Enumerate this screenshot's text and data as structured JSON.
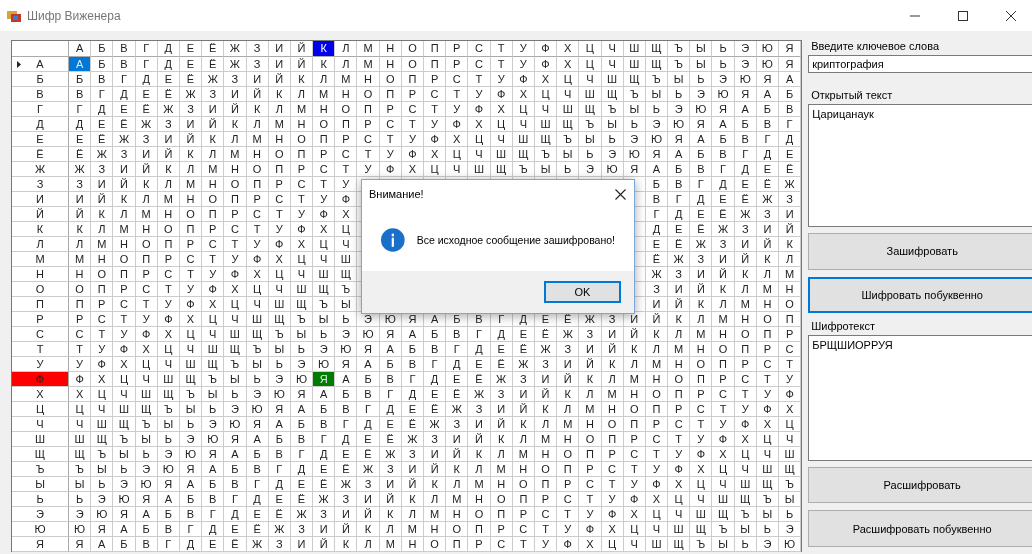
{
  "window": {
    "title": "Шифр Виженера"
  },
  "table": {
    "columns": [
      {
        "label": "А",
        "selected": false
      },
      {
        "label": "Б",
        "selected": false
      },
      {
        "label": "В",
        "selected": false
      },
      {
        "label": "Г",
        "selected": false
      },
      {
        "label": "Д",
        "selected": false
      },
      {
        "label": "Е",
        "selected": false
      },
      {
        "label": "Ё",
        "selected": false
      },
      {
        "label": "Ж",
        "selected": false
      },
      {
        "label": "З",
        "selected": false
      },
      {
        "label": "И",
        "selected": false
      },
      {
        "label": "Й",
        "selected": false
      },
      {
        "label": "К",
        "selected": true
      },
      {
        "label": "Л",
        "selected": false
      },
      {
        "label": "М",
        "selected": false
      },
      {
        "label": "Н",
        "selected": false
      },
      {
        "label": "О",
        "selected": false
      },
      {
        "label": "П",
        "selected": false
      },
      {
        "label": "Р",
        "selected": false
      },
      {
        "label": "С",
        "selected": false
      },
      {
        "label": "Т",
        "selected": false
      },
      {
        "label": "У",
        "selected": false
      },
      {
        "label": "Ф",
        "selected": false
      },
      {
        "label": "Х",
        "selected": false
      },
      {
        "label": "Ц",
        "selected": false
      },
      {
        "label": "Ч",
        "selected": false
      },
      {
        "label": "Ш",
        "selected": false
      },
      {
        "label": "Щ",
        "selected": false
      },
      {
        "label": "Ъ",
        "selected": false
      },
      {
        "label": "Ы",
        "selected": false
      },
      {
        "label": "Ь",
        "selected": false
      },
      {
        "label": "Э",
        "selected": false
      },
      {
        "label": "Ю",
        "selected": false
      },
      {
        "label": "Я",
        "selected": false
      }
    ],
    "rows": [
      {
        "header": "А",
        "current": true,
        "selected": false,
        "cells": [
          {
            "text": "А",
            "color": "#0078d7"
          },
          "Б",
          "В",
          "Г",
          "Д",
          "Е",
          "Ё",
          "Ж",
          "З",
          "И",
          "Й",
          "К",
          "Л",
          "М",
          "Н",
          "О",
          "П",
          "Р",
          "С",
          "Т",
          "У",
          "Ф",
          "Х",
          "Ц",
          "Ч",
          "Ш",
          "Щ",
          "Ъ",
          "Ы",
          "Ь",
          "Э",
          "Ю",
          "Я"
        ]
      },
      {
        "header": "Б",
        "current": false,
        "selected": false,
        "cells": [
          "Б",
          "В",
          "Г",
          "Д",
          "Е",
          "Ё",
          "Ж",
          "З",
          "И",
          "Й",
          "К",
          "Л",
          "М",
          "Н",
          "О",
          "П",
          "Р",
          "С",
          "Т",
          "У",
          "Ф",
          "Х",
          "Ц",
          "Ч",
          "Ш",
          "Щ",
          "Ъ",
          "Ы",
          "Ь",
          "Э",
          "Ю",
          "Я",
          "А"
        ]
      },
      {
        "header": "В",
        "current": false,
        "selected": false,
        "cells": [
          "В",
          "Г",
          "Д",
          "Е",
          "Ё",
          "Ж",
          "З",
          "И",
          "Й",
          "К",
          "Л",
          "М",
          "Н",
          "О",
          "П",
          "Р",
          "С",
          "Т",
          "У",
          "Ф",
          "Х",
          "Ц",
          "Ч",
          "Ш",
          "Щ",
          "Ъ",
          "Ы",
          "Ь",
          "Э",
          "Ю",
          "Я",
          "А",
          "Б"
        ]
      },
      {
        "header": "Г",
        "current": false,
        "selected": false,
        "cells": [
          "Г",
          "Д",
          "Е",
          "Ё",
          "Ж",
          "З",
          "И",
          "Й",
          "К",
          "Л",
          "М",
          "Н",
          "О",
          "П",
          "Р",
          "С",
          "Т",
          "У",
          "Ф",
          "Х",
          "Ц",
          "Ч",
          "Ш",
          "Щ",
          "Ъ",
          "Ы",
          "Ь",
          "Э",
          "Ю",
          "Я",
          "А",
          "Б",
          "В"
        ]
      },
      {
        "header": "Д",
        "current": false,
        "selected": false,
        "cells": [
          "Д",
          "Е",
          "Ё",
          "Ж",
          "З",
          "И",
          "Й",
          "К",
          "Л",
          "М",
          "Н",
          "О",
          "П",
          "Р",
          "С",
          "Т",
          "У",
          "Ф",
          "Х",
          "Ц",
          "Ч",
          "Ш",
          "Щ",
          "Ъ",
          "Ы",
          "Ь",
          "Э",
          "Ю",
          "Я",
          "А",
          "Б",
          "В",
          "Г"
        ]
      },
      {
        "header": "Е",
        "current": false,
        "selected": false,
        "cells": [
          "Е",
          "Ё",
          "Ж",
          "З",
          "И",
          "Й",
          "К",
          "Л",
          "М",
          "Н",
          "О",
          "П",
          "Р",
          "С",
          "Т",
          "У",
          "Ф",
          "Х",
          "Ц",
          "Ч",
          "Ш",
          "Щ",
          "Ъ",
          "Ы",
          "Ь",
          "Э",
          "Ю",
          "Я",
          "А",
          "Б",
          "В",
          "Г",
          "Д"
        ]
      },
      {
        "header": "Ё",
        "current": false,
        "selected": false,
        "cells": [
          "Ё",
          "Ж",
          "З",
          "И",
          "Й",
          "К",
          "Л",
          "М",
          "Н",
          "О",
          "П",
          "Р",
          "С",
          "Т",
          "У",
          "Ф",
          "Х",
          "Ц",
          "Ч",
          "Ш",
          "Щ",
          "Ъ",
          "Ы",
          "Ь",
          "Э",
          "Ю",
          "Я",
          "А",
          "Б",
          "В",
          "Г",
          "Д",
          "Е"
        ]
      },
      {
        "header": "Ж",
        "current": false,
        "selected": false,
        "cells": [
          "Ж",
          "З",
          "И",
          "Й",
          "К",
          "Л",
          "М",
          "Н",
          "О",
          "П",
          "Р",
          "С",
          "Т",
          "У",
          "Ф",
          "Х",
          "Ц",
          "Ч",
          "Ш",
          "Щ",
          "Ъ",
          "Ы",
          "Ь",
          "Э",
          "Ю",
          "Я",
          "А",
          "Б",
          "В",
          "Г",
          "Д",
          "Е",
          "Ё"
        ]
      },
      {
        "header": "З",
        "current": false,
        "selected": false,
        "cells": [
          "З",
          "И",
          "Й",
          "К",
          "Л",
          "М",
          "Н",
          "О",
          "П",
          "Р",
          "С",
          "Т",
          "У",
          null,
          null,
          null,
          null,
          null,
          null,
          null,
          null,
          null,
          null,
          null,
          null,
          null,
          "Б",
          "В",
          "Г",
          "Д",
          "Е",
          "Ё",
          "Ж"
        ]
      },
      {
        "header": "И",
        "current": false,
        "selected": false,
        "cells": [
          "И",
          "Й",
          "К",
          "Л",
          "М",
          "Н",
          "О",
          "П",
          "Р",
          "С",
          "Т",
          "У",
          "Ф",
          null,
          null,
          null,
          null,
          null,
          null,
          null,
          null,
          null,
          null,
          null,
          null,
          null,
          "В",
          "Г",
          "Д",
          "Е",
          "Ё",
          "Ж",
          "З"
        ]
      },
      {
        "header": "Й",
        "current": false,
        "selected": false,
        "cells": [
          "Й",
          "К",
          "Л",
          "М",
          "Н",
          "О",
          "П",
          "Р",
          "С",
          "Т",
          "У",
          "Ф",
          "Х",
          null,
          null,
          null,
          null,
          null,
          null,
          null,
          null,
          null,
          null,
          null,
          null,
          null,
          "Г",
          "Д",
          "Е",
          "Ё",
          "Ж",
          "З",
          "И"
        ]
      },
      {
        "header": "К",
        "current": false,
        "selected": false,
        "cells": [
          "К",
          "Л",
          "М",
          "Н",
          "О",
          "П",
          "Р",
          "С",
          "Т",
          "У",
          "Ф",
          "Х",
          "Ц",
          null,
          null,
          null,
          null,
          null,
          null,
          null,
          null,
          null,
          null,
          null,
          null,
          null,
          "Д",
          "Е",
          "Ё",
          "Ж",
          "З",
          "И",
          "Й"
        ]
      },
      {
        "header": "Л",
        "current": false,
        "selected": false,
        "cells": [
          "Л",
          "М",
          "Н",
          "О",
          "П",
          "Р",
          "С",
          "Т",
          "У",
          "Ф",
          "Х",
          "Ц",
          "Ч",
          null,
          null,
          null,
          null,
          null,
          null,
          null,
          null,
          null,
          null,
          null,
          null,
          null,
          "Е",
          "Ё",
          "Ж",
          "З",
          "И",
          "Й",
          "К"
        ]
      },
      {
        "header": "М",
        "current": false,
        "selected": false,
        "cells": [
          "М",
          "Н",
          "О",
          "П",
          "Р",
          "С",
          "Т",
          "У",
          "Ф",
          "Х",
          "Ц",
          "Ч",
          "Ш",
          null,
          null,
          null,
          null,
          null,
          null,
          null,
          null,
          null,
          null,
          null,
          null,
          null,
          "Ё",
          "Ж",
          "З",
          "И",
          "Й",
          "К",
          "Л"
        ]
      },
      {
        "header": "Н",
        "current": false,
        "selected": false,
        "cells": [
          "Н",
          "О",
          "П",
          "Р",
          "С",
          "Т",
          "У",
          "Ф",
          "Х",
          "Ц",
          "Ч",
          "Ш",
          "Щ",
          null,
          null,
          null,
          null,
          null,
          null,
          null,
          null,
          null,
          null,
          null,
          null,
          null,
          "Ж",
          "З",
          "И",
          "Й",
          "К",
          "Л",
          "М"
        ]
      },
      {
        "header": "О",
        "current": false,
        "selected": false,
        "cells": [
          "О",
          "П",
          "Р",
          "С",
          "Т",
          "У",
          "Ф",
          "Х",
          "Ц",
          "Ч",
          "Ш",
          "Щ",
          "Ъ",
          null,
          null,
          null,
          null,
          null,
          null,
          null,
          null,
          null,
          null,
          null,
          null,
          null,
          "З",
          "И",
          "Й",
          "К",
          "Л",
          "М",
          "Н"
        ]
      },
      {
        "header": "П",
        "current": false,
        "selected": false,
        "cells": [
          "П",
          "Р",
          "С",
          "Т",
          "У",
          "Ф",
          "Х",
          "Ц",
          "Ч",
          "Ш",
          "Щ",
          "Ъ",
          "Ы",
          null,
          null,
          null,
          null,
          null,
          null,
          null,
          null,
          null,
          null,
          null,
          null,
          null,
          "И",
          "Й",
          "К",
          "Л",
          "М",
          "Н",
          "О"
        ]
      },
      {
        "header": "Р",
        "current": false,
        "selected": false,
        "cells": [
          "Р",
          "С",
          "Т",
          "У",
          "Ф",
          "Х",
          "Ц",
          "Ч",
          "Ш",
          "Щ",
          "Ъ",
          "Ы",
          "Ь",
          "Э",
          "Ю",
          "Я",
          "А",
          "Б",
          "В",
          "Г",
          "Д",
          "Е",
          "Ё",
          "Ж",
          "З",
          "И",
          "Й",
          "К",
          "Л",
          "М",
          "Н",
          "О",
          "П"
        ]
      },
      {
        "header": "С",
        "current": false,
        "selected": false,
        "cells": [
          "С",
          "Т",
          "У",
          "Ф",
          "Х",
          "Ц",
          "Ч",
          "Ш",
          "Щ",
          "Ъ",
          "Ы",
          "Ь",
          "Э",
          "Ю",
          "Я",
          "А",
          "Б",
          "В",
          "Г",
          "Д",
          "Е",
          "Ё",
          "Ж",
          "З",
          "И",
          "Й",
          "К",
          "Л",
          "М",
          "Н",
          "О",
          "П",
          "Р"
        ]
      },
      {
        "header": "Т",
        "current": false,
        "selected": false,
        "cells": [
          "Т",
          "У",
          "Ф",
          "Х",
          "Ц",
          "Ч",
          "Ш",
          "Щ",
          "Ъ",
          "Ы",
          "Ь",
          "Э",
          "Ю",
          "Я",
          "А",
          "Б",
          "В",
          "Г",
          "Д",
          "Е",
          "Ё",
          "Ж",
          "З",
          "И",
          "Й",
          "К",
          "Л",
          "М",
          "Н",
          "О",
          "П",
          "Р",
          "С"
        ]
      },
      {
        "header": "У",
        "current": false,
        "selected": false,
        "cells": [
          "У",
          "Ф",
          "Х",
          "Ц",
          "Ч",
          "Ш",
          "Щ",
          "Ъ",
          "Ы",
          "Ь",
          "Э",
          "Ю",
          "Я",
          "А",
          "Б",
          "В",
          "Г",
          "Д",
          "Е",
          "Ё",
          "Ж",
          "З",
          "И",
          "Й",
          "К",
          "Л",
          "М",
          "Н",
          "О",
          "П",
          "Р",
          "С",
          "Т"
        ]
      },
      {
        "header": "Ф",
        "current": false,
        "selected": true,
        "cells": [
          "Ф",
          "Х",
          "Ц",
          "Ч",
          "Ш",
          "Щ",
          "Ъ",
          "Ы",
          "Ь",
          "Э",
          "Ю",
          {
            "text": "Я",
            "color": "#007d00"
          },
          "А",
          "Б",
          "В",
          "Г",
          "Д",
          "Е",
          "Ё",
          "Ж",
          "З",
          "И",
          "Й",
          "К",
          "Л",
          "М",
          "Н",
          "О",
          "П",
          "Р",
          "С",
          "Т",
          "У"
        ]
      },
      {
        "header": "Х",
        "current": false,
        "selected": false,
        "cells": [
          "Х",
          "Ц",
          "Ч",
          "Ш",
          "Щ",
          "Ъ",
          "Ы",
          "Ь",
          "Э",
          "Ю",
          "Я",
          "А",
          "Б",
          "В",
          "Г",
          "Д",
          "Е",
          "Ё",
          "Ж",
          "З",
          "И",
          "Й",
          "К",
          "Л",
          "М",
          "Н",
          "О",
          "П",
          "Р",
          "С",
          "Т",
          "У",
          "Ф"
        ]
      },
      {
        "header": "Ц",
        "current": false,
        "selected": false,
        "cells": [
          "Ц",
          "Ч",
          "Ш",
          "Щ",
          "Ъ",
          "Ы",
          "Ь",
          "Э",
          "Ю",
          "Я",
          "А",
          "Б",
          "В",
          "Г",
          "Д",
          "Е",
          "Ё",
          "Ж",
          "З",
          "И",
          "Й",
          "К",
          "Л",
          "М",
          "Н",
          "О",
          "П",
          "Р",
          "С",
          "Т",
          "У",
          "Ф",
          "Х"
        ]
      },
      {
        "header": "Ч",
        "current": false,
        "selected": false,
        "cells": [
          "Ч",
          "Ш",
          "Щ",
          "Ъ",
          "Ы",
          "Ь",
          "Э",
          "Ю",
          "Я",
          "А",
          "Б",
          "В",
          "Г",
          "Д",
          "Е",
          "Ё",
          "Ж",
          "З",
          "И",
          "Й",
          "К",
          "Л",
          "М",
          "Н",
          "О",
          "П",
          "Р",
          "С",
          "Т",
          "У",
          "Ф",
          "Х",
          "Ц"
        ]
      },
      {
        "header": "Ш",
        "current": false,
        "selected": false,
        "cells": [
          "Ш",
          "Щ",
          "Ъ",
          "Ы",
          "Ь",
          "Э",
          "Ю",
          "Я",
          "А",
          "Б",
          "В",
          "Г",
          "Д",
          "Е",
          "Ё",
          "Ж",
          "З",
          "И",
          "Й",
          "К",
          "Л",
          "М",
          "Н",
          "О",
          "П",
          "Р",
          "С",
          "Т",
          "У",
          "Ф",
          "Х",
          "Ц",
          "Ч"
        ]
      },
      {
        "header": "Щ",
        "current": false,
        "selected": false,
        "cells": [
          "Щ",
          "Ъ",
          "Ы",
          "Ь",
          "Э",
          "Ю",
          "Я",
          "А",
          "Б",
          "В",
          "Г",
          "Д",
          "Е",
          "Ё",
          "Ж",
          "З",
          "И",
          "Й",
          "К",
          "Л",
          "М",
          "Н",
          "О",
          "П",
          "Р",
          "С",
          "Т",
          "У",
          "Ф",
          "Х",
          "Ц",
          "Ч",
          "Ш"
        ]
      },
      {
        "header": "Ъ",
        "current": false,
        "selected": false,
        "cells": [
          "Ъ",
          "Ы",
          "Ь",
          "Э",
          "Ю",
          "Я",
          "А",
          "Б",
          "В",
          "Г",
          "Д",
          "Е",
          "Ё",
          "Ж",
          "З",
          "И",
          "Й",
          "К",
          "Л",
          "М",
          "Н",
          "О",
          "П",
          "Р",
          "С",
          "Т",
          "У",
          "Ф",
          "Х",
          "Ц",
          "Ч",
          "Ш",
          "Щ"
        ]
      },
      {
        "header": "Ы",
        "current": false,
        "selected": false,
        "cells": [
          "Ы",
          "Ь",
          "Э",
          "Ю",
          "Я",
          "А",
          "Б",
          "В",
          "Г",
          "Д",
          "Е",
          "Ё",
          "Ж",
          "З",
          "И",
          "Й",
          "К",
          "Л",
          "М",
          "Н",
          "О",
          "П",
          "Р",
          "С",
          "Т",
          "У",
          "Ф",
          "Х",
          "Ц",
          "Ч",
          "Ш",
          "Щ",
          "Ъ"
        ]
      },
      {
        "header": "Ь",
        "current": false,
        "selected": false,
        "cells": [
          "Ь",
          "Э",
          "Ю",
          "Я",
          "А",
          "Б",
          "В",
          "Г",
          "Д",
          "Е",
          "Ё",
          "Ж",
          "З",
          "И",
          "Й",
          "К",
          "Л",
          "М",
          "Н",
          "О",
          "П",
          "Р",
          "С",
          "Т",
          "У",
          "Ф",
          "Х",
          "Ц",
          "Ч",
          "Ш",
          "Щ",
          "Ъ",
          "Ы"
        ]
      },
      {
        "header": "Э",
        "current": false,
        "selected": false,
        "cells": [
          "Э",
          "Ю",
          "Я",
          "А",
          "Б",
          "В",
          "Г",
          "Д",
          "Е",
          "Ё",
          "Ж",
          "З",
          "И",
          "Й",
          "К",
          "Л",
          "М",
          "Н",
          "О",
          "П",
          "Р",
          "С",
          "Т",
          "У",
          "Ф",
          "Х",
          "Ц",
          "Ч",
          "Ш",
          "Щ",
          "Ъ",
          "Ы",
          "Ь"
        ]
      },
      {
        "header": "Ю",
        "current": false,
        "selected": false,
        "cells": [
          "Ю",
          "Я",
          "А",
          "Б",
          "В",
          "Г",
          "Д",
          "Е",
          "Ё",
          "Ж",
          "З",
          "И",
          "Й",
          "К",
          "Л",
          "М",
          "Н",
          "О",
          "П",
          "Р",
          "С",
          "Т",
          "У",
          "Ф",
          "Х",
          "Ц",
          "Ч",
          "Ш",
          "Щ",
          "Ъ",
          "Ы",
          "Ь",
          "Э"
        ]
      },
      {
        "header": "Я",
        "current": false,
        "selected": false,
        "cells": [
          "Я",
          "А",
          "Б",
          "В",
          "Г",
          "Д",
          "Е",
          "Ё",
          "Ж",
          "З",
          "И",
          "Й",
          "К",
          "Л",
          "М",
          "Н",
          "О",
          "П",
          "Р",
          "С",
          "Т",
          "У",
          "Ф",
          "Х",
          "Ц",
          "Ч",
          "Ш",
          "Щ",
          "Ъ",
          "Ы",
          "Ь",
          "Э",
          "Ю"
        ]
      }
    ]
  },
  "panel": {
    "items": [
      {
        "kind": "label",
        "text": "Введите ключевое слова"
      },
      {
        "kind": "input",
        "value": "криптография"
      },
      {
        "kind": "label",
        "text": "Открытый текст"
      },
      {
        "kind": "textarea",
        "value": "Царицанаук"
      },
      {
        "kind": "button",
        "text": "Зашифровать",
        "focused": false
      },
      {
        "kind": "button",
        "text": "Шифровать побуквенно",
        "focused": true
      },
      {
        "kind": "label",
        "text": "Шифротекст"
      },
      {
        "kind": "textarea",
        "value": "БРЩШИОРРУЯ"
      },
      {
        "kind": "button",
        "text": "Расшифровать",
        "focused": false
      },
      {
        "kind": "button",
        "text": "Расшифровать побуквенно",
        "focused": false
      }
    ]
  },
  "dialog": {
    "title": "Внимание!",
    "message": "Все исходное сообщение зашифровано!",
    "button": "OK"
  }
}
